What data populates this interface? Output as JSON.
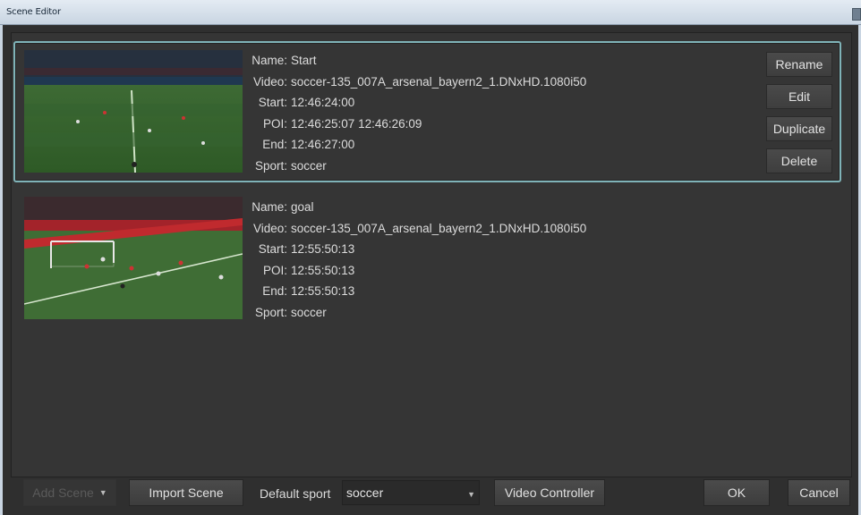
{
  "window": {
    "title": "Scene Editor"
  },
  "scenes": [
    {
      "name_label": "Name:",
      "name": "Start",
      "video_label": "Video:",
      "video": "soccer-135_007A_arsenal_bayern2_1.DNxHD.1080i50",
      "start_label": "Start:",
      "start": "12:46:24:00",
      "poi_label": "POI:",
      "poi": "12:46:25:07 12:46:26:09",
      "end_label": "End:",
      "end": "12:46:27:00",
      "sport_label": "Sport:",
      "sport": "soccer"
    },
    {
      "name_label": "Name:",
      "name": "goal",
      "video_label": "Video:",
      "video": "soccer-135_007A_arsenal_bayern2_1.DNxHD.1080i50",
      "start_label": "Start:",
      "start": "12:55:50:13",
      "poi_label": "POI:",
      "poi": "12:55:50:13",
      "end_label": "End:",
      "end": "12:55:50:13",
      "sport_label": "Sport:",
      "sport": "soccer"
    }
  ],
  "scene_actions": {
    "rename": "Rename",
    "edit": "Edit",
    "duplicate": "Duplicate",
    "delete": "Delete"
  },
  "bottom": {
    "add_scene": "Add Scene",
    "import_scene": "Import Scene",
    "default_sport_label": "Default sport",
    "default_sport_value": "soccer",
    "video_controller": "Video Controller",
    "ok": "OK",
    "cancel": "Cancel"
  },
  "colors": {
    "selection_border": "#7fb3b8",
    "background": "#353535"
  }
}
